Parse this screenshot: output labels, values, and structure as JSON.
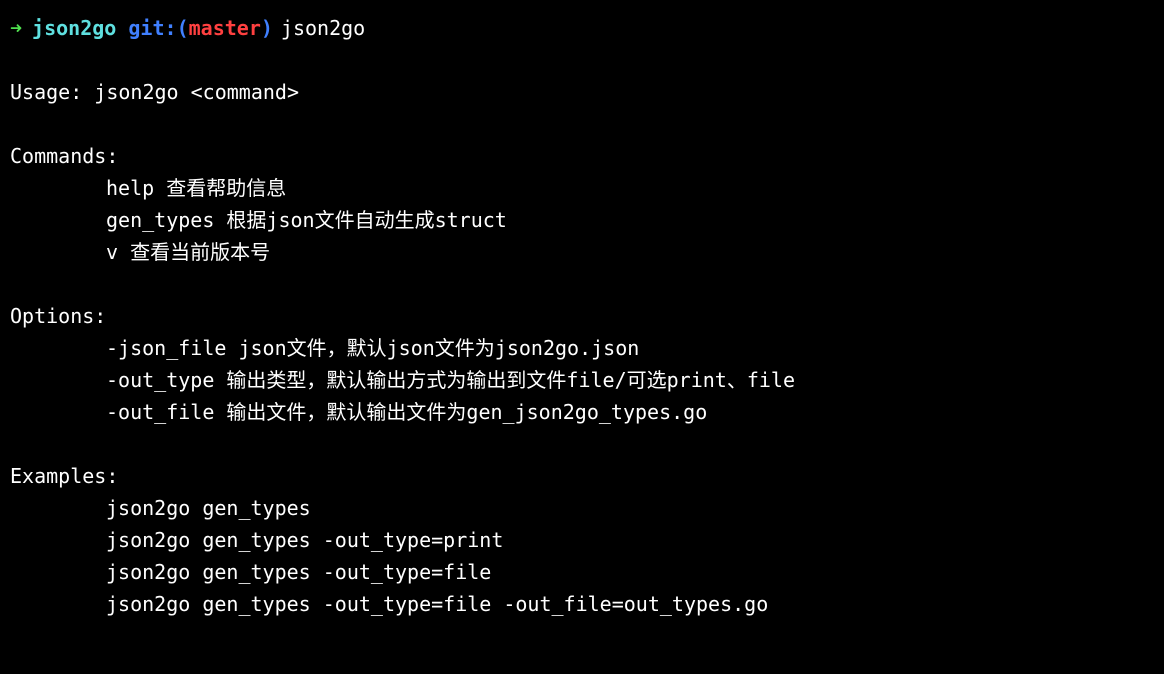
{
  "prompt": {
    "arrow": "➜",
    "directory": "json2go",
    "git_label": "git:",
    "paren_open": "(",
    "branch": "master",
    "paren_close": ")",
    "command": "json2go"
  },
  "usage": {
    "label": "Usage: json2go <command>"
  },
  "commands_header": "Commands:",
  "commands": [
    {
      "name": "help",
      "desc": "查看帮助信息",
      "spacing": "    "
    },
    {
      "name": "gen_types",
      "desc": "根据json文件自动生成struct",
      "spacing": "       "
    },
    {
      "name": "v",
      "desc": "查看当前版本号",
      "spacing": "       "
    }
  ],
  "options_header": "Options:",
  "options": [
    {
      "flag": "-json_file",
      "desc": "json文件，默认json文件为json2go.json",
      "spacing": "       "
    },
    {
      "flag": "-out_type",
      "desc": "输出类型，默认输出方式为输出到文件file/可选print、file",
      "spacing": "        "
    },
    {
      "flag": "-out_file",
      "desc": "输出文件，默认输出文件为gen_json2go_types.go",
      "spacing": "        "
    }
  ],
  "examples_header": "Examples:",
  "examples": [
    "json2go gen_types",
    "json2go gen_types -out_type=print",
    "json2go gen_types -out_type=file",
    "json2go gen_types -out_type=file -out_file=out_types.go"
  ]
}
